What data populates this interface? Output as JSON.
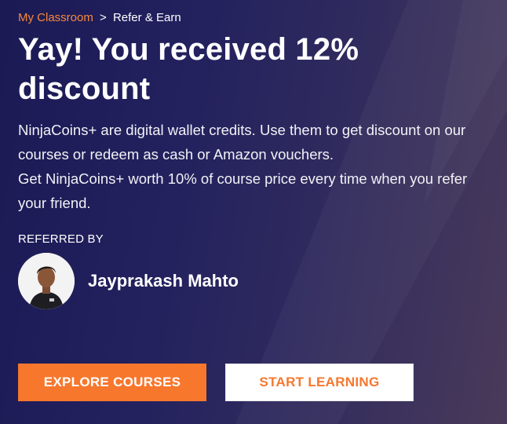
{
  "breadcrumb": {
    "link_label": "My Classroom",
    "separator": ">",
    "current_label": "Refer & Earn"
  },
  "heading": {
    "title": "Yay! You received 12% discount"
  },
  "description": {
    "line1": "NinjaCoins+ are digital wallet credits. Use them to get discount on our courses or redeem as cash or Amazon vouchers.",
    "line2": "Get NinjaCoins+ worth 10% of course price every time when you refer your friend."
  },
  "referral": {
    "label": "REFERRED BY",
    "name": "Jayprakash Mahto"
  },
  "actions": {
    "explore_label": "EXPLORE COURSES",
    "start_label": "START LEARNING"
  },
  "colors": {
    "accent": "#f7772d",
    "background": "#1f1d5a"
  }
}
